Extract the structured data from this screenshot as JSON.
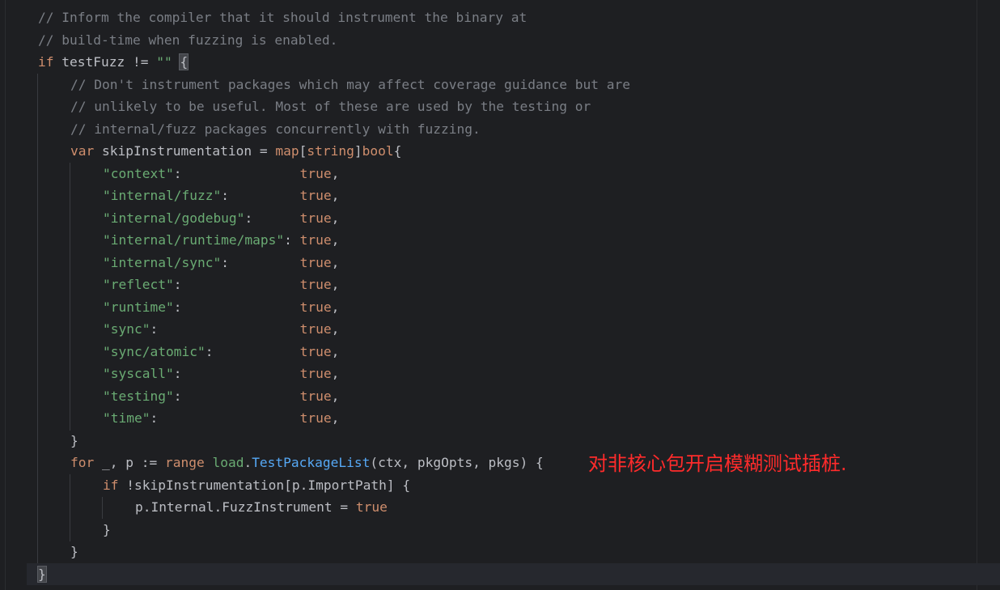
{
  "editor": {
    "colors": {
      "background": "#1e1f22",
      "comment": "#7a7e85",
      "keyword": "#cf8e6d",
      "string": "#6aab73",
      "function": "#56a8f5",
      "text": "#bcbec4",
      "annotation": "#ff2b2b"
    },
    "lines": [
      {
        "indent": 0,
        "tokens": [
          {
            "t": "// Inform the compiler that it should instrument the binary at",
            "c": "comment"
          }
        ]
      },
      {
        "indent": 0,
        "tokens": [
          {
            "t": "// build-time when fuzzing is enabled.",
            "c": "comment"
          }
        ]
      },
      {
        "indent": 0,
        "tokens": [
          {
            "t": "if",
            "c": "keyword"
          },
          {
            "t": " testFuzz != ",
            "c": "plain"
          },
          {
            "t": "\"\"",
            "c": "string"
          },
          {
            "t": " ",
            "c": "plain"
          },
          {
            "t": "{",
            "c": "brace"
          }
        ]
      },
      {
        "indent": 1,
        "tokens": [
          {
            "t": "// Don't instrument packages which may affect coverage guidance but are",
            "c": "comment"
          }
        ]
      },
      {
        "indent": 1,
        "tokens": [
          {
            "t": "// unlikely to be useful. Most of these are used by the testing or",
            "c": "comment"
          }
        ]
      },
      {
        "indent": 1,
        "tokens": [
          {
            "t": "// internal/fuzz packages concurrently with fuzzing.",
            "c": "comment"
          }
        ]
      },
      {
        "indent": 1,
        "tokens": [
          {
            "t": "var",
            "c": "keyword"
          },
          {
            "t": " skipInstrumentation = ",
            "c": "plain"
          },
          {
            "t": "map",
            "c": "keyword"
          },
          {
            "t": "[",
            "c": "plain"
          },
          {
            "t": "string",
            "c": "keyword"
          },
          {
            "t": "]",
            "c": "plain"
          },
          {
            "t": "bool",
            "c": "keyword"
          },
          {
            "t": "{",
            "c": "plain"
          }
        ]
      },
      {
        "indent": 2,
        "tokens": [
          {
            "t": "\"context\"",
            "c": "string"
          },
          {
            "t": ":               ",
            "c": "plain"
          },
          {
            "t": "true",
            "c": "keyword"
          },
          {
            "t": ",",
            "c": "plain"
          }
        ]
      },
      {
        "indent": 2,
        "tokens": [
          {
            "t": "\"internal/fuzz\"",
            "c": "string"
          },
          {
            "t": ":         ",
            "c": "plain"
          },
          {
            "t": "true",
            "c": "keyword"
          },
          {
            "t": ",",
            "c": "plain"
          }
        ]
      },
      {
        "indent": 2,
        "tokens": [
          {
            "t": "\"internal/godebug\"",
            "c": "string"
          },
          {
            "t": ":      ",
            "c": "plain"
          },
          {
            "t": "true",
            "c": "keyword"
          },
          {
            "t": ",",
            "c": "plain"
          }
        ]
      },
      {
        "indent": 2,
        "tokens": [
          {
            "t": "\"internal/runtime/maps\"",
            "c": "string"
          },
          {
            "t": ": ",
            "c": "plain"
          },
          {
            "t": "true",
            "c": "keyword"
          },
          {
            "t": ",",
            "c": "plain"
          }
        ]
      },
      {
        "indent": 2,
        "tokens": [
          {
            "t": "\"internal/sync\"",
            "c": "string"
          },
          {
            "t": ":         ",
            "c": "plain"
          },
          {
            "t": "true",
            "c": "keyword"
          },
          {
            "t": ",",
            "c": "plain"
          }
        ]
      },
      {
        "indent": 2,
        "tokens": [
          {
            "t": "\"reflect\"",
            "c": "string"
          },
          {
            "t": ":               ",
            "c": "plain"
          },
          {
            "t": "true",
            "c": "keyword"
          },
          {
            "t": ",",
            "c": "plain"
          }
        ]
      },
      {
        "indent": 2,
        "tokens": [
          {
            "t": "\"runtime\"",
            "c": "string"
          },
          {
            "t": ":               ",
            "c": "plain"
          },
          {
            "t": "true",
            "c": "keyword"
          },
          {
            "t": ",",
            "c": "plain"
          }
        ]
      },
      {
        "indent": 2,
        "tokens": [
          {
            "t": "\"sync\"",
            "c": "string"
          },
          {
            "t": ":                  ",
            "c": "plain"
          },
          {
            "t": "true",
            "c": "keyword"
          },
          {
            "t": ",",
            "c": "plain"
          }
        ]
      },
      {
        "indent": 2,
        "tokens": [
          {
            "t": "\"sync/atomic\"",
            "c": "string"
          },
          {
            "t": ":           ",
            "c": "plain"
          },
          {
            "t": "true",
            "c": "keyword"
          },
          {
            "t": ",",
            "c": "plain"
          }
        ]
      },
      {
        "indent": 2,
        "tokens": [
          {
            "t": "\"syscall\"",
            "c": "string"
          },
          {
            "t": ":               ",
            "c": "plain"
          },
          {
            "t": "true",
            "c": "keyword"
          },
          {
            "t": ",",
            "c": "plain"
          }
        ]
      },
      {
        "indent": 2,
        "tokens": [
          {
            "t": "\"testing\"",
            "c": "string"
          },
          {
            "t": ":               ",
            "c": "plain"
          },
          {
            "t": "true",
            "c": "keyword"
          },
          {
            "t": ",",
            "c": "plain"
          }
        ]
      },
      {
        "indent": 2,
        "tokens": [
          {
            "t": "\"time\"",
            "c": "string"
          },
          {
            "t": ":                  ",
            "c": "plain"
          },
          {
            "t": "true",
            "c": "keyword"
          },
          {
            "t": ",",
            "c": "plain"
          }
        ]
      },
      {
        "indent": 1,
        "tokens": [
          {
            "t": "}",
            "c": "plain"
          }
        ]
      },
      {
        "indent": 1,
        "tokens": [
          {
            "t": "for",
            "c": "keyword"
          },
          {
            "t": " _, p := ",
            "c": "plain"
          },
          {
            "t": "range",
            "c": "keyword"
          },
          {
            "t": " ",
            "c": "plain"
          },
          {
            "t": "load",
            "c": "string"
          },
          {
            "t": ".",
            "c": "plain"
          },
          {
            "t": "TestPackageList",
            "c": "func"
          },
          {
            "t": "(ctx, pkgOpts, pkgs) {",
            "c": "plain"
          }
        ]
      },
      {
        "indent": 2,
        "tokens": [
          {
            "t": "if",
            "c": "keyword"
          },
          {
            "t": " !skipInstrumentation[p.ImportPath] {",
            "c": "plain"
          }
        ]
      },
      {
        "indent": 3,
        "tokens": [
          {
            "t": "p.Internal.FuzzInstrument = ",
            "c": "plain"
          },
          {
            "t": "true",
            "c": "keyword"
          }
        ]
      },
      {
        "indent": 2,
        "tokens": [
          {
            "t": "}",
            "c": "plain"
          }
        ]
      },
      {
        "indent": 1,
        "tokens": [
          {
            "t": "}",
            "c": "plain"
          }
        ]
      },
      {
        "indent": 0,
        "tokens": [
          {
            "t": "}",
            "c": "brace"
          }
        ]
      }
    ]
  },
  "annotation": {
    "text": "对非核心包开启模糊测试插桩."
  }
}
